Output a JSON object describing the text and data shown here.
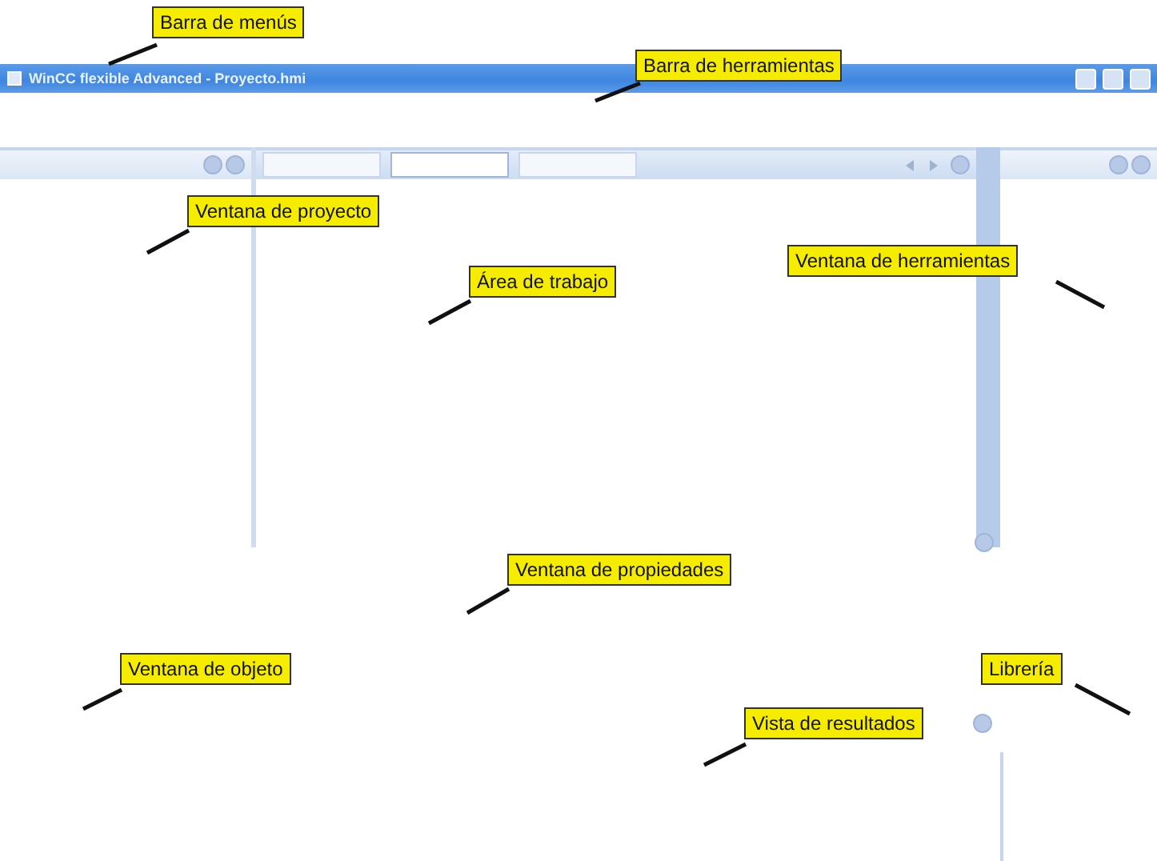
{
  "window": {
    "title": "WinCC flexible Advanced - Proyecto.hmi"
  },
  "callouts": [
    {
      "text": "Barra de menús"
    },
    {
      "text": "Barra de herramientas"
    },
    {
      "text": "Ventana de proyecto"
    },
    {
      "text": "Área de trabajo"
    },
    {
      "text": "Ventana de herramientas"
    },
    {
      "text": "Ventana de propiedades"
    },
    {
      "text": "Ventana de objeto"
    },
    {
      "text": "Librería"
    },
    {
      "text": "Vista de resultados"
    }
  ],
  "editor_tabs": [
    {
      "selected": false
    },
    {
      "selected": true
    },
    {
      "selected": false
    }
  ]
}
